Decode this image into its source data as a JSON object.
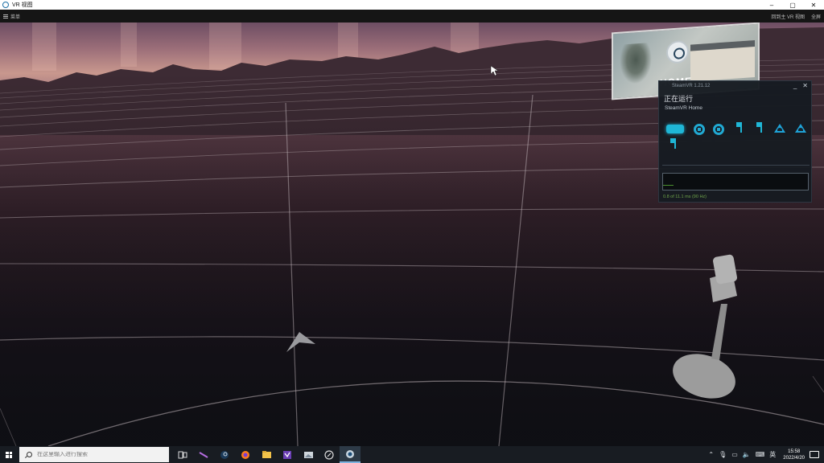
{
  "window": {
    "title": "VR 视图",
    "controls": [
      "–",
      "▢",
      "✕"
    ]
  },
  "menubar": {
    "menu_label": "菜单",
    "right_items": [
      "回到主 VR 视图",
      "全屏"
    ]
  },
  "home_thumbnail": {
    "label": "HOME"
  },
  "steamvr_panel": {
    "version": "SteamVR 1.21.12",
    "status": "正在运行",
    "app_name": "SteamVR Home",
    "minimize": "_",
    "close": "✕",
    "devices": [
      "headset",
      "controller",
      "controller",
      "tracker",
      "tracker",
      "base-station",
      "base-station",
      "tracker"
    ],
    "timing": "0.8 of 11.1 ms (90 Hz)",
    "frame_fraction": 0.07
  },
  "taskbar": {
    "search_placeholder": "在这里输入进行搜索",
    "apps": [
      "task-view",
      "app-stylus",
      "steam",
      "firefox",
      "file-explorer",
      "visual-studio",
      "app-gallery",
      "app-circle",
      "steamvr"
    ],
    "active_app": "steamvr",
    "time": "15:58",
    "date": "2022/4/20",
    "tray_icons": [
      "chevron-up-icon",
      "mic-icon",
      "network-icon",
      "speaker-icon",
      "keyboard-icon",
      "ime-icon"
    ],
    "ime_label": "英"
  },
  "colors": {
    "accent": "#1fb6d6",
    "panel_bg": "#161b21",
    "taskbar_bg": "#181c22"
  }
}
